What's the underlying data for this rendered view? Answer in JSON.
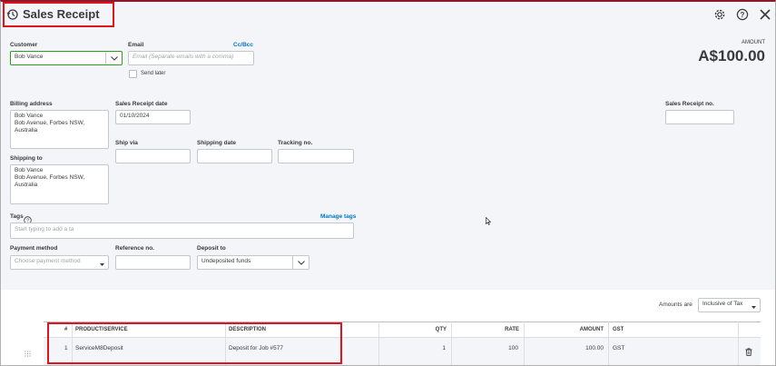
{
  "header": {
    "title": "Sales Receipt",
    "icons": [
      "history-icon",
      "gear-icon",
      "help-icon",
      "close-icon"
    ]
  },
  "customer": {
    "label": "Customer",
    "value": "Bob Vance"
  },
  "email": {
    "label": "Email",
    "placeholder": "Email (Separate emails with a comma)",
    "cc_bcc": "Cc/Bcc",
    "send_later": "Send later"
  },
  "amount": {
    "label": "AMOUNT",
    "value": "A$100.00"
  },
  "billing": {
    "label": "Billing address",
    "lines": [
      "Bob Vance",
      "Bob Avenue, Forbes NSW,",
      "Australia"
    ]
  },
  "shipping_to": {
    "label": "Shipping to",
    "lines": [
      "Bob Vance",
      "Bob Avenue, Forbes NSW,",
      "Australia"
    ]
  },
  "receipt_date": {
    "label": "Sales Receipt date",
    "value": "01/10/2024"
  },
  "receipt_no": {
    "label": "Sales Receipt no.",
    "value": ""
  },
  "ship_via": {
    "label": "Ship via",
    "value": ""
  },
  "shipping_date": {
    "label": "Shipping date",
    "value": ""
  },
  "tracking_no": {
    "label": "Tracking no.",
    "value": ""
  },
  "tags": {
    "label": "Tags",
    "manage": "Manage tags",
    "placeholder": "Start typing to add a ta"
  },
  "payment_method": {
    "label": "Payment method",
    "placeholder": "Choose payment method"
  },
  "reference_no": {
    "label": "Reference no.",
    "value": ""
  },
  "deposit_to": {
    "label": "Deposit to",
    "value": "Undeposited funds"
  },
  "amounts_are": {
    "label": "Amounts are",
    "value": "Inclusive of Tax"
  },
  "table": {
    "headers": {
      "num": "#",
      "product": "PRODUCT/SERVICE",
      "description": "DESCRIPTION",
      "qty": "QTY",
      "rate": "RATE",
      "amount": "AMOUNT",
      "gst": "GST"
    },
    "rows": [
      {
        "num": "1",
        "product": "ServiceM8Deposit",
        "description": "Deposit for Job #577",
        "qty": "1",
        "rate": "100",
        "amount": "100.00",
        "gst": "GST"
      }
    ]
  },
  "colors": {
    "accent_link": "#0077c5",
    "highlight": "#e0141e",
    "customer_border": "#2ca01c"
  }
}
